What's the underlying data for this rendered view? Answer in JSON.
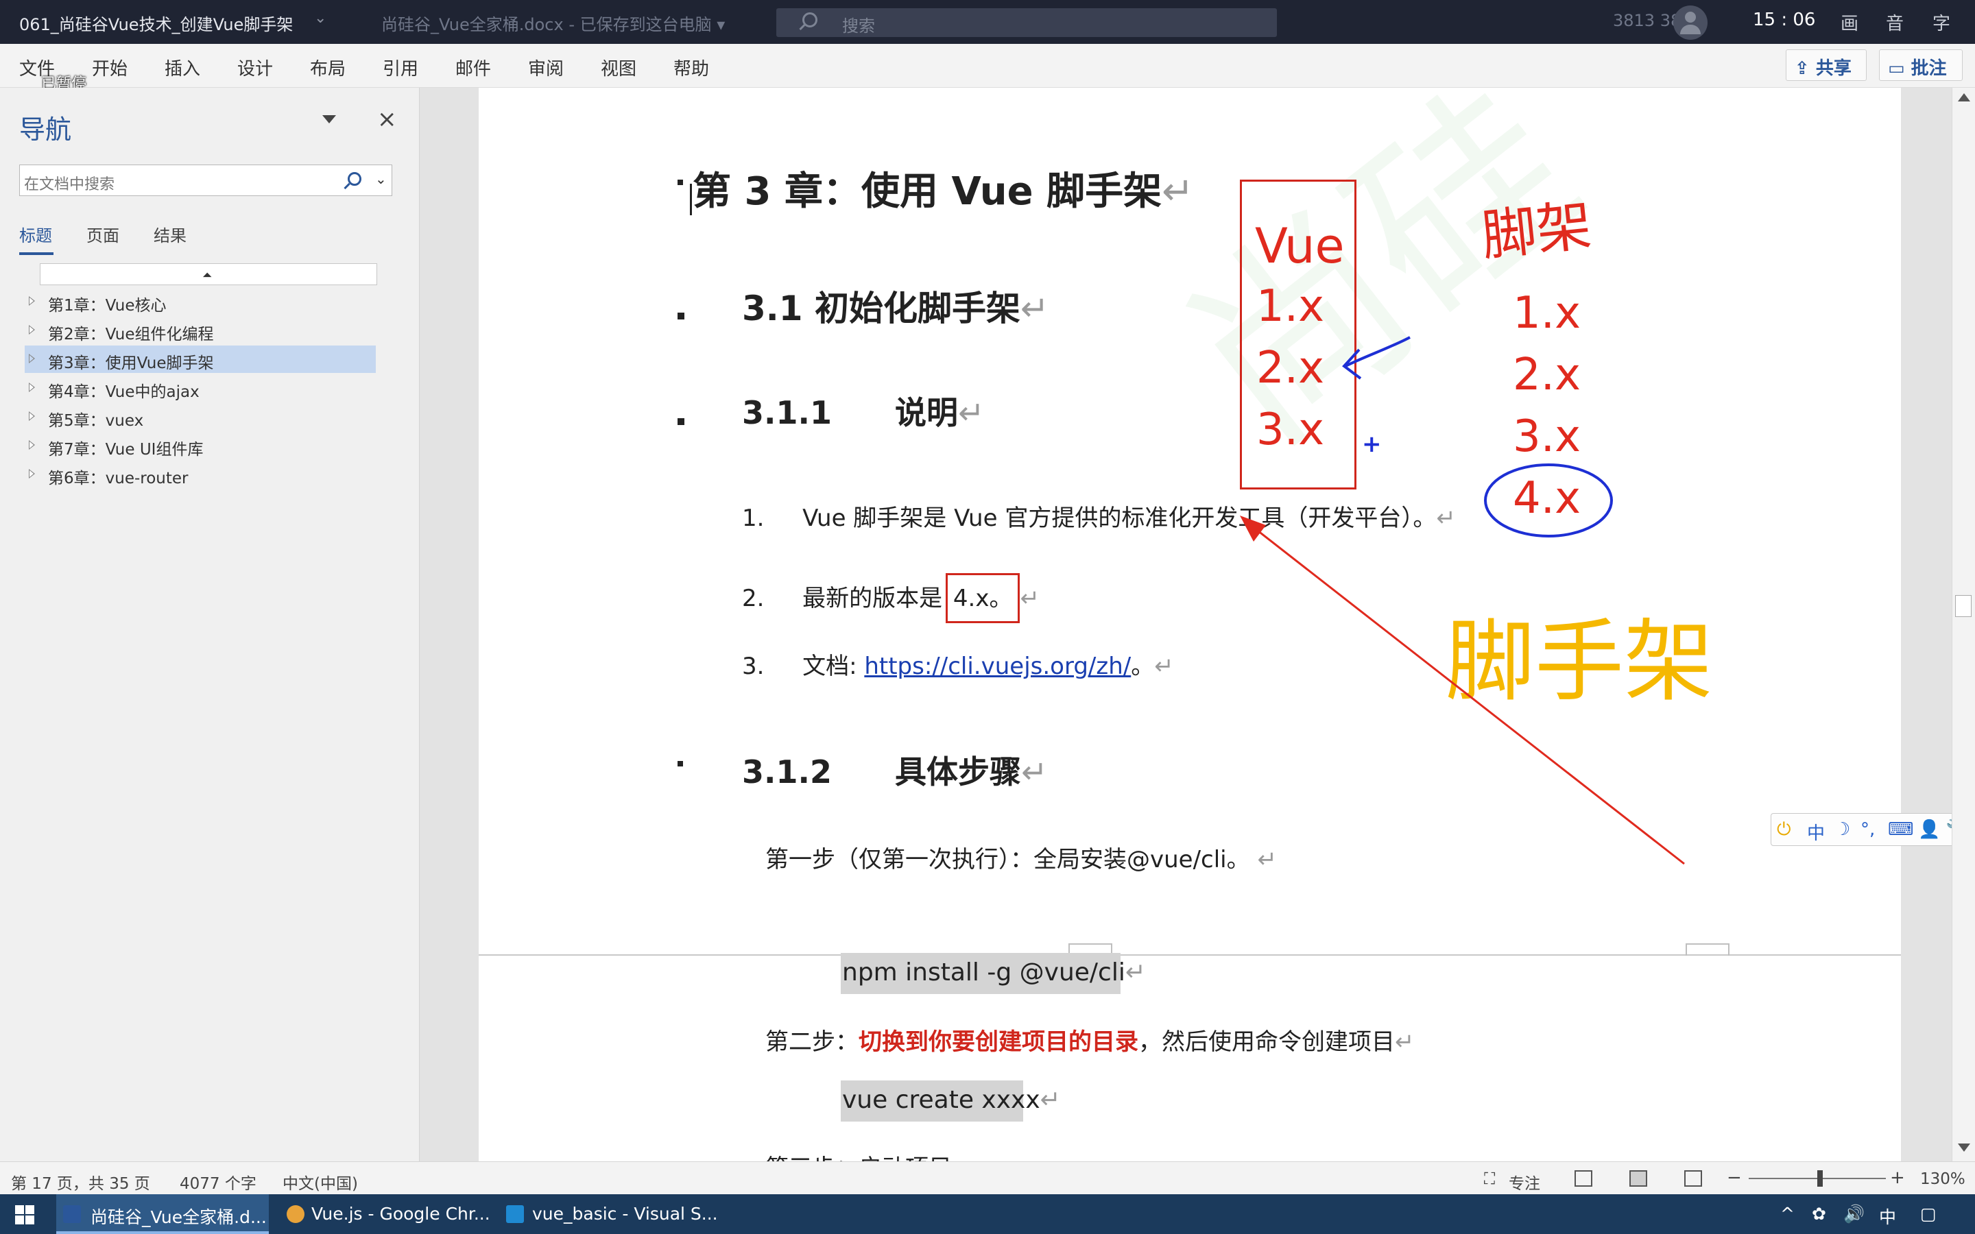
{
  "titlebar": {
    "left_title": "061_尚硅谷Vue技术_创建Vue脚手架",
    "doc_name": "尚硅谷_Vue全家桶.docx - 已保存到这台电脑 ▾",
    "search_placeholder": "搜索",
    "user": "3813 3813",
    "clock": "15 : 06",
    "ctl_draw": "画",
    "ctl_sound": "音",
    "ctl_caption": "字"
  },
  "ribbon": {
    "tabs": [
      "文件",
      "开始",
      "插入",
      "设计",
      "布局",
      "引用",
      "邮件",
      "审阅",
      "视图",
      "帮助"
    ],
    "paused_label": "已暂停",
    "share": "共享",
    "comment": "批注"
  },
  "nav": {
    "title": "导航",
    "search_placeholder": "在文档中搜索",
    "tabs": [
      "标题",
      "页面",
      "结果"
    ],
    "headings": [
      "第1章：Vue核心",
      "第2章：Vue组件化编程",
      "第3章：使用Vue脚手架",
      "第4章：Vue中的ajax",
      "第5章：vuex",
      "第7章：Vue UI组件库",
      "第6章：vue-router"
    ]
  },
  "doc": {
    "watermark": "尚硅",
    "h1": "第 3 章：使用 Vue 脚手架",
    "h2": "3.1   初始化脚手架",
    "h3a_num": "3.1.1",
    "h3a_text": "说明",
    "list": [
      {
        "num": "1.",
        "text": "Vue 脚手架是 Vue 官方提供的标准化开发工具（开发平台）。"
      },
      {
        "num": "2.",
        "text": "最新的版本是 ",
        "boxed": "4.x。"
      },
      {
        "num": "3.",
        "text": "文档: ",
        "link": "https://cli.vuejs.org/zh/",
        "after": "。"
      }
    ],
    "h3b_num": "3.1.2",
    "h3b_text": "具体步骤",
    "step1": "第一步（仅第一次执行）：全局安装@vue/cli。",
    "code1": "npm install -g @vue/cli",
    "step2_prefix": "第二步：",
    "step2_emph": "切换到你要创建项目的目录",
    "step2_suffix": "，然后使用命令创建项目",
    "code2": "vue create xxxx",
    "step3_partial": "第三步：启动项目",
    "para_mark": "↵"
  },
  "annotations": {
    "box_items": [
      "Vue",
      "1.x",
      "2.x",
      "3.x"
    ],
    "right_items": [
      "1.x",
      "2.x",
      "3.x",
      "4.x"
    ],
    "handwriting": "脚架",
    "yellow_label": "脚手架",
    "plus": "+"
  },
  "ime": {
    "items": [
      "中",
      "☽",
      "°,",
      "⌨",
      "👤",
      "🔧"
    ]
  },
  "statusbar": {
    "page": "第 17 页，共 35 页",
    "words": "4077 个字",
    "lang": "中文(中国)",
    "focus": "专注",
    "zoom_minus": "−",
    "zoom_plus": "+",
    "zoom": "130%",
    "zoom_level": 0.52
  },
  "taskbar": {
    "tasks": [
      "尚硅谷_Vue全家桶.d...",
      "Vue.js - Google Chr...",
      "vue_basic - Visual S..."
    ],
    "ime": "中",
    "colors": {
      "word": "#2b579a",
      "chrome": "#e8a33a",
      "vscode": "#1f8ad2"
    }
  },
  "colors": {
    "accent": "#2b579a",
    "annotation_red": "#e02a1e",
    "annotation_yellow": "#f5b800",
    "annotation_blue": "#1d2fd4"
  }
}
